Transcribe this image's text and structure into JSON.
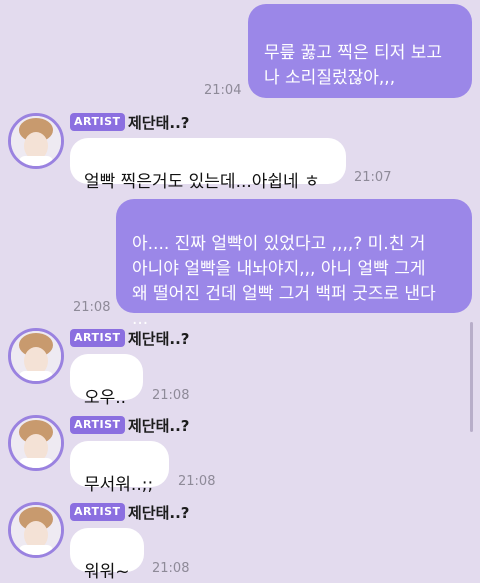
{
  "messages": [
    {
      "type": "out",
      "text": "무릎 꿇고 찍은 티저 보고\n나 소리질렀잖아,,,",
      "time": "21:04"
    },
    {
      "type": "in",
      "badge": "ARTIST",
      "name": "제단태..?",
      "text": "얼빡 찍은거도 있는데...아쉽네 ㅎ",
      "time": "21:07"
    },
    {
      "type": "out",
      "text": "아.... 진짜 얼빡이 있었다고 ,,,,? 미.친 거\n아니야 얼빡을 내놔야지,,, 아니 얼빡 그게\n왜 떨어진 건데 얼빡 그거 백퍼 굿즈로 낸다\n...",
      "time": "21:08"
    },
    {
      "type": "in",
      "badge": "ARTIST",
      "name": "제단태..?",
      "text": "오우..",
      "time": "21:08"
    },
    {
      "type": "in",
      "badge": "ARTIST",
      "name": "제단태..?",
      "text": "무서워..;;",
      "time": "21:08"
    },
    {
      "type": "in",
      "badge": "ARTIST",
      "name": "제단태..?",
      "text": "워워~",
      "time": "21:08"
    }
  ],
  "colors": {
    "background": "#e3dbee",
    "outgoing_bubble": "#9b87e8",
    "incoming_bubble": "#ffffff",
    "badge": "#8b6fe0"
  },
  "icons": {
    "avatar": "artist-avatar-icon"
  }
}
